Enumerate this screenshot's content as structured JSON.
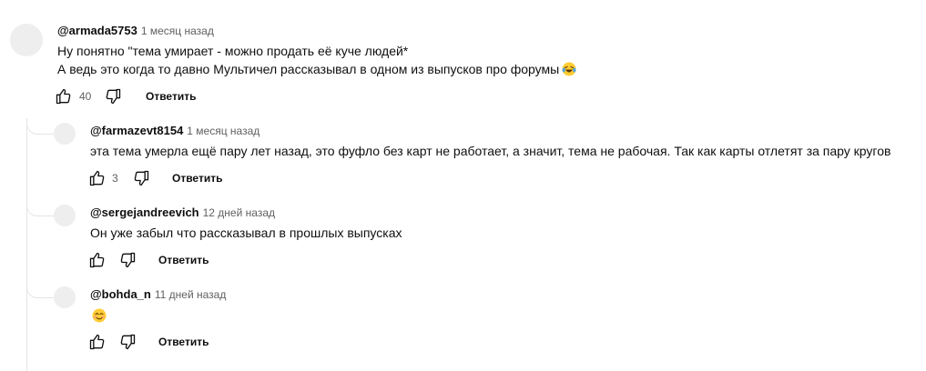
{
  "comments": [
    {
      "author": "@armada5753",
      "time": "1 месяц назад",
      "lines": [
        "Ну понятно \"тема умирает - можно продать её куче людей*",
        "А ведь это когда то давно Мультичел рассказывал в одном из выпусков про форумы"
      ],
      "likes": "40",
      "reply_label": "Ответить"
    },
    {
      "author": "@farmazevt8154",
      "time": "1 месяц назад",
      "lines": [
        "эта тема умерла ещё пару лет назад, это фуфло без карт не работает, а значит, тема не рабочая. Так как карты отлетят за пару кругов"
      ],
      "likes": "3",
      "reply_label": "Ответить"
    },
    {
      "author": "@sergejandreevich",
      "time": "12 дней назад",
      "lines": [
        "Он уже забыл что рассказывал в прошлых выпусках"
      ],
      "likes": "",
      "reply_label": "Ответить"
    },
    {
      "author": "@bohda_n",
      "time": "11 дней назад",
      "lines": [],
      "likes": "",
      "reply_label": "Ответить"
    }
  ],
  "icons": {
    "like": "thumb-up-icon",
    "dislike": "thumb-down-icon",
    "emoji_laugh": "laughing-tears-emoji",
    "emoji_smile": "smiling-face-emoji"
  },
  "colors": {
    "text": "#0f0f0f",
    "secondary": "#606060",
    "avatar_placeholder": "#eeeeee",
    "thread_line": "#e5e5e5"
  }
}
